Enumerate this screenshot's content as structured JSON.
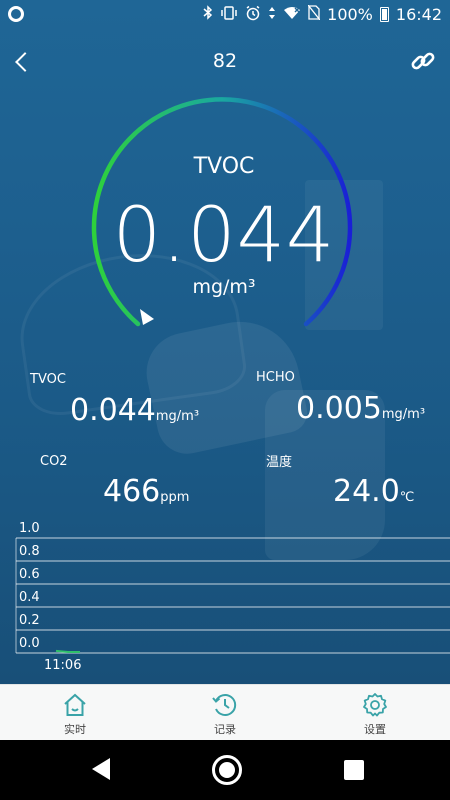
{
  "status_bar": {
    "battery_percent": "100%",
    "time": "16:42",
    "icons": [
      "camera-notification-icon",
      "bluetooth-icon",
      "vibrate-icon",
      "alarm-icon",
      "data-transfer-icon",
      "wifi-icon",
      "no-sim-icon",
      "battery-charging-icon"
    ]
  },
  "header": {
    "title": "82",
    "back_icon": "chevron-left-icon",
    "share_icon": "link-icon"
  },
  "gauge": {
    "label": "TVOC",
    "value": "0.044",
    "unit": "mg/m³",
    "arc_color_start": "#2ed13c",
    "arc_color_end": "#1a1fd6",
    "pointer_icon": "triangle-pointer-icon"
  },
  "readings": {
    "tvoc": {
      "label": "TVOC",
      "value": "0.044",
      "unit": "mg/m³"
    },
    "hcho": {
      "label": "HCHO",
      "value": "0.005",
      "unit": "mg/m³"
    },
    "co2": {
      "label": "CO2",
      "value": "466",
      "unit": "ppm"
    },
    "temperature": {
      "label": "温度",
      "value": "24.0",
      "unit": "℃"
    }
  },
  "chart_data": {
    "type": "line",
    "title": "",
    "xlabel": "",
    "ylabel": "",
    "ylim": [
      0,
      1.0
    ],
    "y_ticks": [
      "1.0",
      "0.8",
      "0.6",
      "0.4",
      "0.2",
      "0.0"
    ],
    "x_ticks": [
      "11:06"
    ],
    "series": [
      {
        "values": [
          0.01,
          0.0,
          0.0
        ]
      }
    ],
    "grid": true,
    "line_color": "#2fc06a"
  },
  "tabs": [
    {
      "label": "实时",
      "icon": "home-icon",
      "color": "#3aa3a8"
    },
    {
      "label": "记录",
      "icon": "history-clock-icon",
      "color": "#3aa3a8"
    },
    {
      "label": "设置",
      "icon": "gear-icon",
      "color": "#3aa3a8"
    }
  ],
  "nav": {
    "back": "nav-back-icon",
    "home": "nav-home-icon",
    "recent": "nav-recent-apps-icon"
  }
}
